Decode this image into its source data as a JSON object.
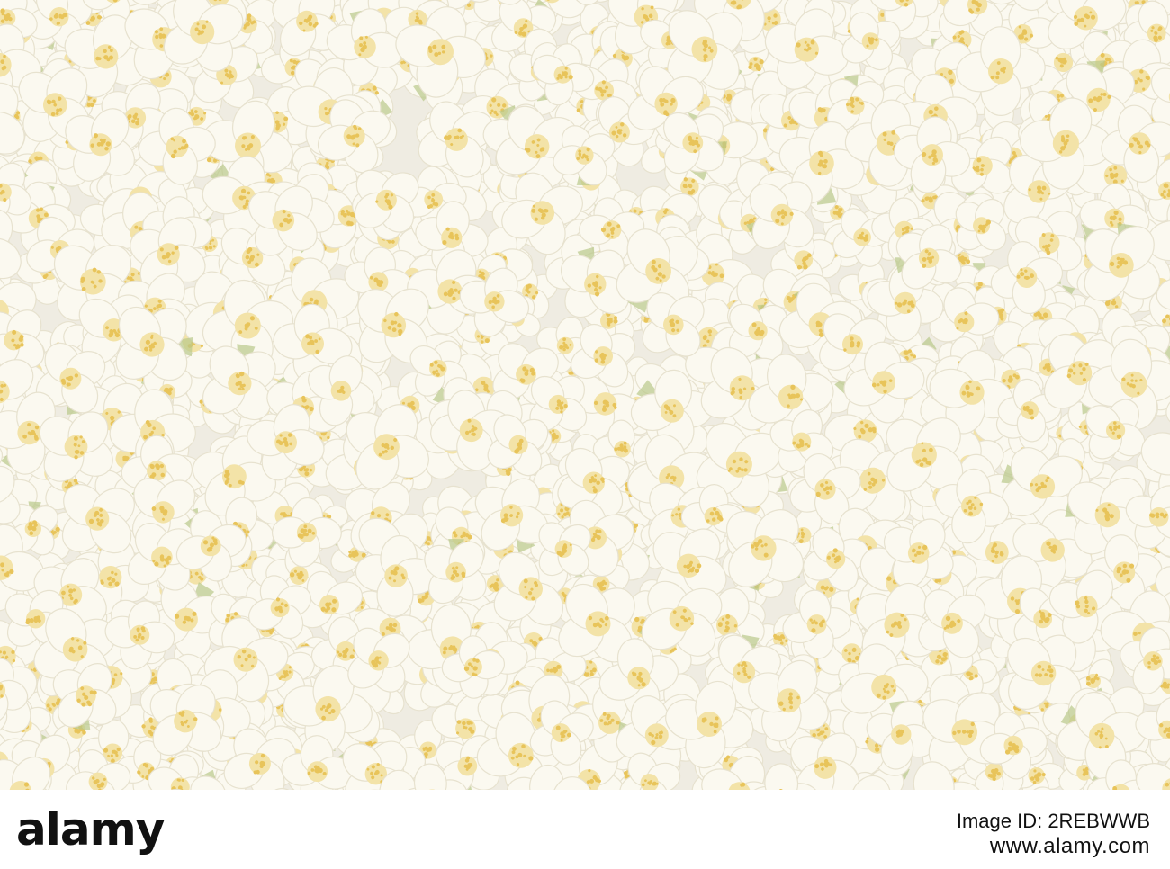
{
  "photo": {
    "subject": "white-flowers-blossoms",
    "colors": {
      "background": "#efece2",
      "petal": "#fbf9f0",
      "petal_shadow": "#e7e2cf",
      "stamen": "#e8c45a",
      "stamen_center": "#f3e3a8",
      "leaf": "#b9c98a"
    }
  },
  "footer": {
    "logo_text": "alamy",
    "image_id_label": "Image ID: 2REBWWB",
    "image_url": "www.alamy.com"
  }
}
